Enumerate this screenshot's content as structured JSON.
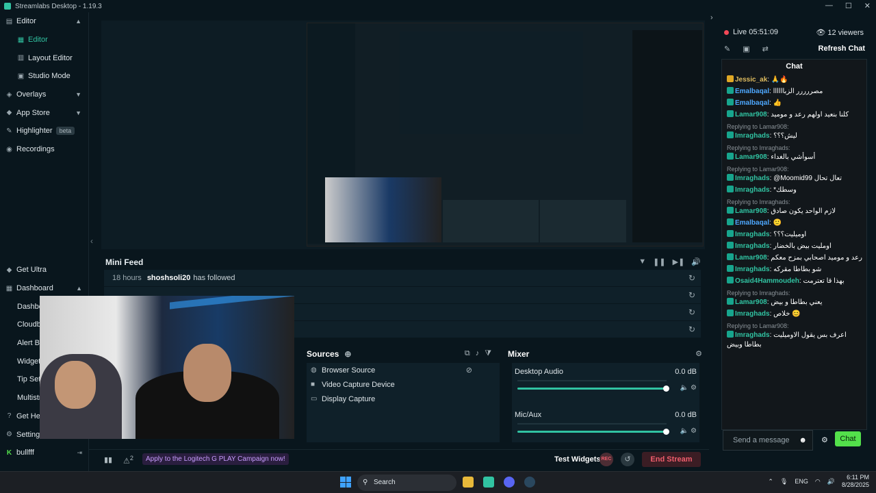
{
  "app": {
    "title": "Streamlabs Desktop - 1.19.3"
  },
  "sidebar": {
    "items": [
      {
        "label": "Editor",
        "icon": "editor-icon",
        "chevron": "▲"
      },
      {
        "label": "Editor",
        "icon": "grid-icon"
      },
      {
        "label": "Layout Editor",
        "icon": "layout-icon"
      },
      {
        "label": "Studio Mode",
        "icon": "studio-icon"
      },
      {
        "label": "Overlays",
        "icon": "overlays-icon",
        "chevron": "▼"
      },
      {
        "label": "App Store",
        "icon": "store-icon",
        "chevron": "▼"
      },
      {
        "label": "Highlighter",
        "icon": "highlighter-icon",
        "badge": "beta"
      },
      {
        "label": "Recordings",
        "icon": "recordings-icon"
      }
    ],
    "bottom": [
      {
        "label": "Get Ultra",
        "icon": "ultra-icon"
      },
      {
        "label": "Dashboard",
        "icon": "dashboard-icon",
        "chevron": "▲"
      },
      {
        "label": "Dashboard"
      },
      {
        "label": "Cloudbot"
      },
      {
        "label": "Alert Box"
      },
      {
        "label": "Widgets"
      },
      {
        "label": "Tip Settings"
      },
      {
        "label": "Multistream"
      },
      {
        "label": "Get Help",
        "icon": "help-icon"
      },
      {
        "label": "Settings",
        "icon": "settings-icon"
      },
      {
        "label": "bullfff",
        "icon": "kick-icon"
      }
    ]
  },
  "minifeed": {
    "title": "Mini Feed",
    "rows": [
      {
        "time": "18 hours",
        "user": "shoshsoli20",
        "action": "has followed"
      },
      {
        "time": "",
        "user": "",
        "action": ""
      },
      {
        "time": "",
        "user": "",
        "action": ""
      },
      {
        "time": "",
        "user": "",
        "action": ""
      }
    ]
  },
  "sources": {
    "title": "Sources",
    "items": [
      "Browser Source",
      "Video Capture Device",
      "Display Capture"
    ]
  },
  "mixer": {
    "title": "Mixer",
    "tracks": [
      {
        "name": "Desktop Audio",
        "db": "0.0 dB",
        "level": 1.0
      },
      {
        "name": "Mic/Aux",
        "db": "0.0 dB",
        "level": 1.0
      }
    ]
  },
  "footer": {
    "promo": "Apply to the Logitech G PLAY Campaign now!",
    "alert_count": "2",
    "test_widgets": "Test Widgets",
    "rec": "REC",
    "end_stream": "End Stream"
  },
  "chat_panel": {
    "live": "Live 05:51:09",
    "viewers": "12 viewers",
    "refresh": "Refresh Chat",
    "title": "Chat",
    "messages": [
      {
        "reply": "",
        "user": "Jessic_ak",
        "color": "gold",
        "text": "🙏🔥"
      },
      {
        "reply": "",
        "user": "Emalbaqal",
        "color": "blue",
        "text": "مصررررر الزباااااا"
      },
      {
        "reply": "",
        "user": "Emalbaqal",
        "color": "blue",
        "text": "👍"
      },
      {
        "reply": "",
        "user": "Lamar908",
        "color": "green",
        "text": "كلنا بنعيد اولهم رعد و موميد"
      },
      {
        "reply": "Replying to Lamar908:",
        "user": "Imraghads",
        "color": "green",
        "text": "ليش؟؟؟"
      },
      {
        "reply": "Replying to Imraghads:",
        "user": "Lamar908",
        "color": "green",
        "text": "أسوأشي بالغداء"
      },
      {
        "reply": "Replying to Lamar908:",
        "user": "Imraghads",
        "color": "green",
        "text": "@Moomid99 تعال تحال"
      },
      {
        "reply": "",
        "user": "Imraghads",
        "color": "green",
        "text": "*وسطك"
      },
      {
        "reply": "Replying to Imraghads:",
        "user": "Lamar908",
        "color": "green",
        "text": "لازم الواحد يكون صادق"
      },
      {
        "reply": "",
        "user": "Emalbaqal",
        "color": "blue",
        "text": "🙂"
      },
      {
        "reply": "",
        "user": "Imraghads",
        "color": "green",
        "text": "اوميليت؟؟؟"
      },
      {
        "reply": "",
        "user": "Imraghads",
        "color": "green",
        "text": "اومليت بيض بالخضار"
      },
      {
        "reply": "",
        "user": "Lamar908",
        "color": "green",
        "text": "رعد و موميد اصحابي بمزح معكم"
      },
      {
        "reply": "",
        "user": "Imraghads",
        "color": "green",
        "text": "شو بطاطا مقركه"
      },
      {
        "reply": "",
        "user": "Osaid4Hammoudeh",
        "color": "green",
        "text": "بهذا قا تعترمت"
      },
      {
        "reply": "Replying to Imraghads:",
        "user": "Lamar908",
        "color": "green",
        "text": "يعني بطاطا و بيض"
      },
      {
        "reply": "",
        "user": "Imraghads",
        "color": "green",
        "text": "خلاص 😊"
      },
      {
        "reply": "Replying to Lamar908:",
        "user": "Imraghads",
        "color": "green",
        "text": "اعرف بس يقول الاوميليت بطاطا وبيض"
      }
    ],
    "input_placeholder": "Send a message",
    "send_label": "Chat"
  },
  "taskbar": {
    "search": "Search",
    "lang": "ENG",
    "time": "6:11 PM",
    "date": "8/28/2025"
  }
}
